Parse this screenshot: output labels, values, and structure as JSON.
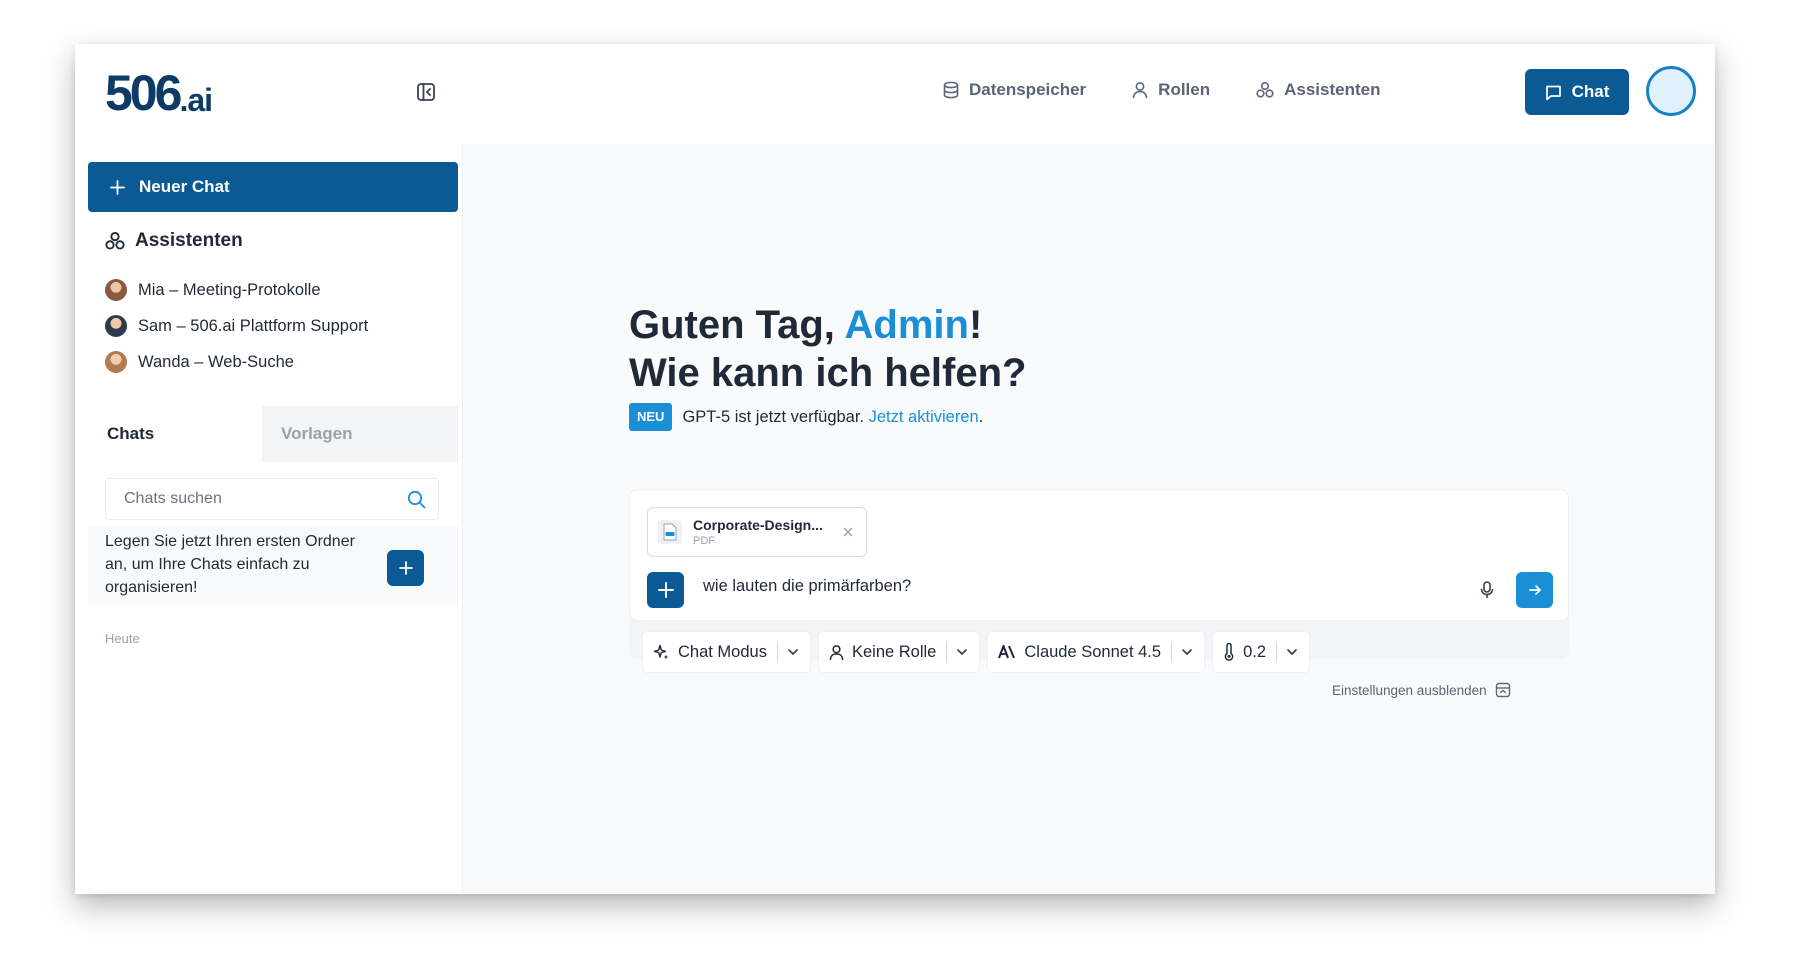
{
  "header": {
    "logo_main": "506",
    "logo_suffix": ".ai",
    "nav": [
      {
        "label": "Datenspeicher",
        "icon": "database-icon"
      },
      {
        "label": "Rollen",
        "icon": "user-icon"
      },
      {
        "label": "Assistenten",
        "icon": "assistants-icon"
      }
    ],
    "chat_button": "Chat"
  },
  "sidebar": {
    "new_chat": "Neuer Chat",
    "assistants_title": "Assistenten",
    "assistants": [
      {
        "name": "Mia – Meeting-Protokolle"
      },
      {
        "name": "Sam – 506.ai Plattform Support"
      },
      {
        "name": "Wanda – Web-Suche"
      }
    ],
    "tabs": [
      "Chats",
      "Vorlagen"
    ],
    "search_placeholder": "Chats suchen",
    "folder_hint": "Legen Sie jetzt Ihren ersten Ordner an, um Ihre Chats einfach zu organisieren!",
    "section_today": "Heute"
  },
  "main": {
    "greeting_prefix": "Guten Tag, ",
    "greeting_name": "Admin",
    "greeting_suffix": "!",
    "greeting_line2": "Wie kann ich helfen?",
    "notice_badge": "NEU",
    "notice_text": "GPT-5 ist jetzt verfügbar.",
    "notice_link": "Jetzt aktivieren",
    "notice_end": ".",
    "attachment": {
      "name": "Corporate-Design...",
      "type": "PDF"
    },
    "message": "wie lauten die primärfarben?",
    "options": {
      "mode": "Chat Modus",
      "role": "Keine Rolle",
      "model": "Claude Sonnet 4.5",
      "temperature": "0.2"
    },
    "settings_toggle": "Einstellungen ausblenden"
  },
  "colors": {
    "primary": "#0b5a96",
    "accent": "#1a8fd6",
    "text": "#1f2937",
    "muted": "#5b6478"
  }
}
